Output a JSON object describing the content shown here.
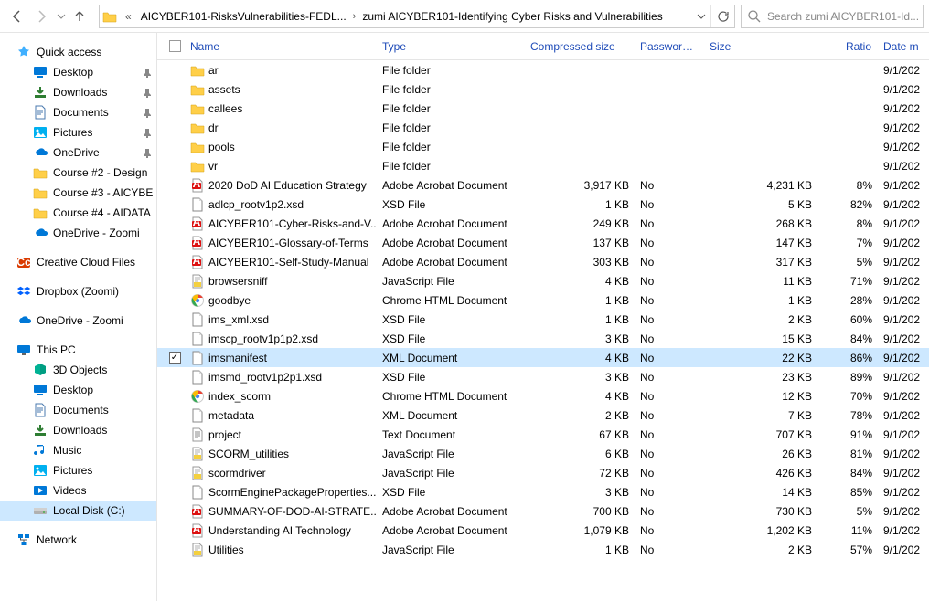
{
  "breadcrumb": {
    "folder_trunc": "AICYBER101-RisksVulnerabilities-FEDL...",
    "final": "zumi AICYBER101-Identifying Cyber Risks and Vulnerabilities"
  },
  "search": {
    "placeholder": "Search zumi AICYBER101-Id..."
  },
  "columns": {
    "name": "Name",
    "type": "Type",
    "compressed": "Compressed size",
    "password": "Password ...",
    "size": "Size",
    "ratio": "Ratio",
    "date": "Date m"
  },
  "sidebar": {
    "quick": "Quick access",
    "items1": [
      {
        "label": "Desktop",
        "icon": "desktop",
        "pinned": true
      },
      {
        "label": "Downloads",
        "icon": "downloads",
        "pinned": true
      },
      {
        "label": "Documents",
        "icon": "documents",
        "pinned": true
      },
      {
        "label": "Pictures",
        "icon": "pictures",
        "pinned": true
      },
      {
        "label": "OneDrive",
        "icon": "onedrive",
        "pinned": true
      },
      {
        "label": "Course #2 - Design",
        "icon": "folder",
        "pinned": false
      },
      {
        "label": "Course #3 - AICYBE",
        "icon": "folder",
        "pinned": false
      },
      {
        "label": "Course #4 - AIDATA",
        "icon": "folder",
        "pinned": false
      },
      {
        "label": "OneDrive - Zoomi",
        "icon": "onedrive",
        "pinned": false
      }
    ],
    "cc": "Creative Cloud Files",
    "dropbox": "Dropbox (Zoomi)",
    "onedrive": "OneDrive - Zoomi",
    "thispc": "This PC",
    "pcitems": [
      {
        "label": "3D Objects",
        "icon": "3d"
      },
      {
        "label": "Desktop",
        "icon": "desktop"
      },
      {
        "label": "Documents",
        "icon": "documents"
      },
      {
        "label": "Downloads",
        "icon": "downloads"
      },
      {
        "label": "Music",
        "icon": "music"
      },
      {
        "label": "Pictures",
        "icon": "pictures"
      },
      {
        "label": "Videos",
        "icon": "videos"
      },
      {
        "label": "Local Disk (C:)",
        "icon": "drive",
        "selected": true
      }
    ],
    "network": "Network"
  },
  "files": [
    {
      "name": "ar",
      "type": "File folder",
      "comp": "",
      "pass": "",
      "size": "",
      "ratio": "",
      "date": "9/1/202",
      "icon": "folder"
    },
    {
      "name": "assets",
      "type": "File folder",
      "comp": "",
      "pass": "",
      "size": "",
      "ratio": "",
      "date": "9/1/202",
      "icon": "folder"
    },
    {
      "name": "callees",
      "type": "File folder",
      "comp": "",
      "pass": "",
      "size": "",
      "ratio": "",
      "date": "9/1/202",
      "icon": "folder"
    },
    {
      "name": "dr",
      "type": "File folder",
      "comp": "",
      "pass": "",
      "size": "",
      "ratio": "",
      "date": "9/1/202",
      "icon": "folder"
    },
    {
      "name": "pools",
      "type": "File folder",
      "comp": "",
      "pass": "",
      "size": "",
      "ratio": "",
      "date": "9/1/202",
      "icon": "folder"
    },
    {
      "name": "vr",
      "type": "File folder",
      "comp": "",
      "pass": "",
      "size": "",
      "ratio": "",
      "date": "9/1/202",
      "icon": "folder"
    },
    {
      "name": "2020 DoD AI Education Strategy",
      "type": "Adobe Acrobat Document",
      "comp": "3,917 KB",
      "pass": "No",
      "size": "4,231 KB",
      "ratio": "8%",
      "date": "9/1/202",
      "icon": "pdf"
    },
    {
      "name": "adlcp_rootv1p2.xsd",
      "type": "XSD File",
      "comp": "1 KB",
      "pass": "No",
      "size": "5 KB",
      "ratio": "82%",
      "date": "9/1/202",
      "icon": "file"
    },
    {
      "name": "AICYBER101-Cyber-Risks-and-V...",
      "type": "Adobe Acrobat Document",
      "comp": "249 KB",
      "pass": "No",
      "size": "268 KB",
      "ratio": "8%",
      "date": "9/1/202",
      "icon": "pdf"
    },
    {
      "name": "AICYBER101-Glossary-of-Terms",
      "type": "Adobe Acrobat Document",
      "comp": "137 KB",
      "pass": "No",
      "size": "147 KB",
      "ratio": "7%",
      "date": "9/1/202",
      "icon": "pdf"
    },
    {
      "name": "AICYBER101-Self-Study-Manual",
      "type": "Adobe Acrobat Document",
      "comp": "303 KB",
      "pass": "No",
      "size": "317 KB",
      "ratio": "5%",
      "date": "9/1/202",
      "icon": "pdf"
    },
    {
      "name": "browsersniff",
      "type": "JavaScript File",
      "comp": "4 KB",
      "pass": "No",
      "size": "11 KB",
      "ratio": "71%",
      "date": "9/1/202",
      "icon": "js"
    },
    {
      "name": "goodbye",
      "type": "Chrome HTML Document",
      "comp": "1 KB",
      "pass": "No",
      "size": "1 KB",
      "ratio": "28%",
      "date": "9/1/202",
      "icon": "chrome"
    },
    {
      "name": "ims_xml.xsd",
      "type": "XSD File",
      "comp": "1 KB",
      "pass": "No",
      "size": "2 KB",
      "ratio": "60%",
      "date": "9/1/202",
      "icon": "file"
    },
    {
      "name": "imscp_rootv1p1p2.xsd",
      "type": "XSD File",
      "comp": "3 KB",
      "pass": "No",
      "size": "15 KB",
      "ratio": "84%",
      "date": "9/1/202",
      "icon": "file"
    },
    {
      "name": "imsmanifest",
      "type": "XML Document",
      "comp": "4 KB",
      "pass": "No",
      "size": "22 KB",
      "ratio": "86%",
      "date": "9/1/202",
      "icon": "file",
      "selected": true,
      "checked": true
    },
    {
      "name": "imsmd_rootv1p2p1.xsd",
      "type": "XSD File",
      "comp": "3 KB",
      "pass": "No",
      "size": "23 KB",
      "ratio": "89%",
      "date": "9/1/202",
      "icon": "file"
    },
    {
      "name": "index_scorm",
      "type": "Chrome HTML Document",
      "comp": "4 KB",
      "pass": "No",
      "size": "12 KB",
      "ratio": "70%",
      "date": "9/1/202",
      "icon": "chrome"
    },
    {
      "name": "metadata",
      "type": "XML Document",
      "comp": "2 KB",
      "pass": "No",
      "size": "7 KB",
      "ratio": "78%",
      "date": "9/1/202",
      "icon": "file"
    },
    {
      "name": "project",
      "type": "Text Document",
      "comp": "67 KB",
      "pass": "No",
      "size": "707 KB",
      "ratio": "91%",
      "date": "9/1/202",
      "icon": "txt"
    },
    {
      "name": "SCORM_utilities",
      "type": "JavaScript File",
      "comp": "6 KB",
      "pass": "No",
      "size": "26 KB",
      "ratio": "81%",
      "date": "9/1/202",
      "icon": "js"
    },
    {
      "name": "scormdriver",
      "type": "JavaScript File",
      "comp": "72 KB",
      "pass": "No",
      "size": "426 KB",
      "ratio": "84%",
      "date": "9/1/202",
      "icon": "js"
    },
    {
      "name": "ScormEnginePackageProperties....",
      "type": "XSD File",
      "comp": "3 KB",
      "pass": "No",
      "size": "14 KB",
      "ratio": "85%",
      "date": "9/1/202",
      "icon": "file"
    },
    {
      "name": "SUMMARY-OF-DOD-AI-STRATE...",
      "type": "Adobe Acrobat Document",
      "comp": "700 KB",
      "pass": "No",
      "size": "730 KB",
      "ratio": "5%",
      "date": "9/1/202",
      "icon": "pdf"
    },
    {
      "name": "Understanding AI Technology",
      "type": "Adobe Acrobat Document",
      "comp": "1,079 KB",
      "pass": "No",
      "size": "1,202 KB",
      "ratio": "11%",
      "date": "9/1/202",
      "icon": "pdf"
    },
    {
      "name": "Utilities",
      "type": "JavaScript File",
      "comp": "1 KB",
      "pass": "No",
      "size": "2 KB",
      "ratio": "57%",
      "date": "9/1/202",
      "icon": "js"
    }
  ]
}
